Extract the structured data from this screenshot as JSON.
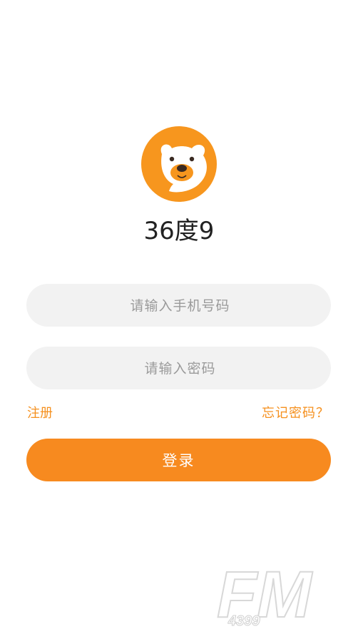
{
  "app": {
    "name": "36度9"
  },
  "login": {
    "phone_placeholder": "请输入手机号码",
    "password_placeholder": "请输入密码",
    "register_label": "注册",
    "forgot_label": "忘记密码？",
    "login_label": "登录"
  },
  "watermark": {
    "brand": "FM",
    "number": "4399"
  },
  "colors": {
    "accent": "#f78a1f",
    "input_bg": "#f2f2f2",
    "link": "#f5901e"
  },
  "icons": {
    "logo": "bear-logo-icon"
  }
}
